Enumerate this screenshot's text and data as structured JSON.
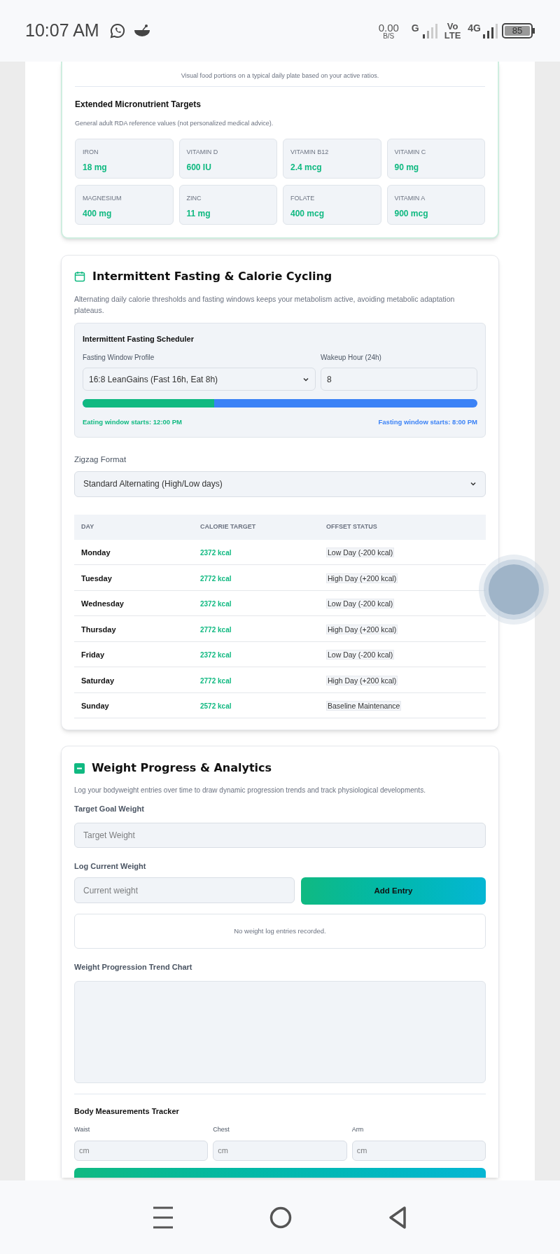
{
  "status_bar": {
    "time": "10:07 AM",
    "net_speed": "0.00",
    "net_unit": "B/S",
    "sim1": "G",
    "volte_top": "Vo",
    "volte_bottom": "LTE",
    "sim2": "4G",
    "battery": "85"
  },
  "plate_card": {
    "caption": "Visual food portions on a typical daily plate based on your active ratios.",
    "micro_title": "Extended Micronutrient Targets",
    "micro_note": "General adult RDA reference values (not personalized medical advice).",
    "nutrients": [
      {
        "name": "IRON",
        "value": "18 mg"
      },
      {
        "name": "VITAMIN D",
        "value": "600 IU"
      },
      {
        "name": "VITAMIN B12",
        "value": "2.4 mcg"
      },
      {
        "name": "VITAMIN C",
        "value": "90 mg"
      },
      {
        "name": "MAGNESIUM",
        "value": "400 mg"
      },
      {
        "name": "ZINC",
        "value": "11 mg"
      },
      {
        "name": "FOLATE",
        "value": "400 mcg"
      },
      {
        "name": "VITAMIN A",
        "value": "900 mcg"
      }
    ]
  },
  "fasting_card": {
    "title": "Intermittent Fasting & Calorie Cycling",
    "description": "Alternating daily calorie thresholds and fasting windows keeps your metabolism active, avoiding metabolic adaptation plateaus.",
    "scheduler": {
      "title": "Intermittent Fasting Scheduler",
      "profile_label": "Fasting Window Profile",
      "profile_value": "16:8 LeanGains (Fast 16h, Eat 8h)",
      "wakeup_label": "Wakeup Hour (24h)",
      "wakeup_value": "8",
      "level": 0.333,
      "eating_text": "Eating window starts: 12:00 PM",
      "fasting_text": "Fasting window starts: 8:00 PM"
    },
    "zigzag_label": "Zigzag Format",
    "zigzag_value": "Standard Alternating (High/Low days)",
    "table": {
      "columns": [
        "DAY",
        "CALORIE TARGET",
        "OFFSET STATUS"
      ],
      "rows": [
        {
          "day": "Monday",
          "calories": "2372 kcal",
          "offset": "Low Day (-200 kcal)"
        },
        {
          "day": "Tuesday",
          "calories": "2772 kcal",
          "offset": "High Day (+200 kcal)"
        },
        {
          "day": "Wednesday",
          "calories": "2372 kcal",
          "offset": "Low Day (-200 kcal)"
        },
        {
          "day": "Thursday",
          "calories": "2772 kcal",
          "offset": "High Day (+200 kcal)"
        },
        {
          "day": "Friday",
          "calories": "2372 kcal",
          "offset": "Low Day (-200 kcal)"
        },
        {
          "day": "Saturday",
          "calories": "2772 kcal",
          "offset": "High Day (+200 kcal)"
        },
        {
          "day": "Sunday",
          "calories": "2572 kcal",
          "offset": "Baseline Maintenance"
        }
      ]
    }
  },
  "weight_card": {
    "title": "Weight Progress & Analytics",
    "description": "Log your bodyweight entries over time to draw dynamic progression trends and track physiological developments.",
    "goal_label": "Target Goal Weight",
    "goal_placeholder": "Target Weight",
    "log_label": "Log Current Weight",
    "log_placeholder": "Current weight",
    "add_button": "Add Entry",
    "empty_text": "No weight log entries recorded.",
    "chart_label": "Weight Progression Trend Chart",
    "measure_title": "Body Measurements Tracker",
    "measurements": [
      {
        "label": "Waist",
        "placeholder": "cm"
      },
      {
        "label": "Chest",
        "placeholder": "cm"
      },
      {
        "label": "Arm",
        "placeholder": "cm"
      }
    ]
  }
}
